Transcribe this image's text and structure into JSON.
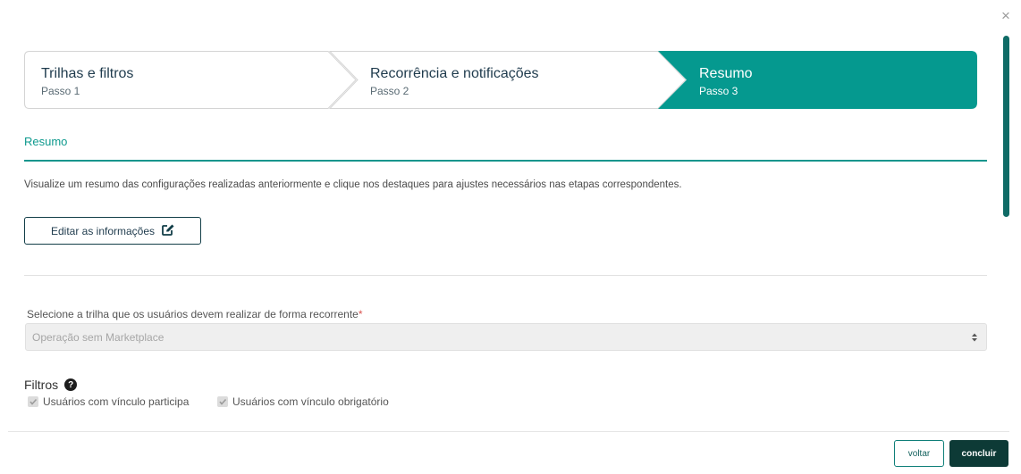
{
  "close_label": "×",
  "stepper": {
    "steps": [
      {
        "title": "Trilhas e filtros",
        "sub": "Passo 1",
        "state": "inactive"
      },
      {
        "title": "Recorrência e notificações",
        "sub": "Passo 2",
        "state": "inactive"
      },
      {
        "title": "Resumo",
        "sub": "Passo 3",
        "state": "active"
      }
    ],
    "active_color": "#05998f"
  },
  "section": {
    "title": "Resumo",
    "description": "Visualize um resumo das configurações realizadas anteriormente e clique nos destaques para ajustes necessários nas etapas correspondentes."
  },
  "edit_button": {
    "label": "Editar as informações",
    "icon": "edit-icon"
  },
  "trail_select": {
    "label": "Selecione a trilha que os usuários devem realizar de forma recorrente",
    "required_mark": "*",
    "value": "Operação sem Marketplace"
  },
  "filters": {
    "label": "Filtros",
    "help_icon": "question-circle-icon",
    "options": [
      {
        "label": "Usuários com vínculo participa",
        "checked": true
      },
      {
        "label": "Usuários com vínculo obrigatório",
        "checked": true
      }
    ]
  },
  "footer": {
    "back_label": "voltar",
    "finish_label": "concluir"
  }
}
